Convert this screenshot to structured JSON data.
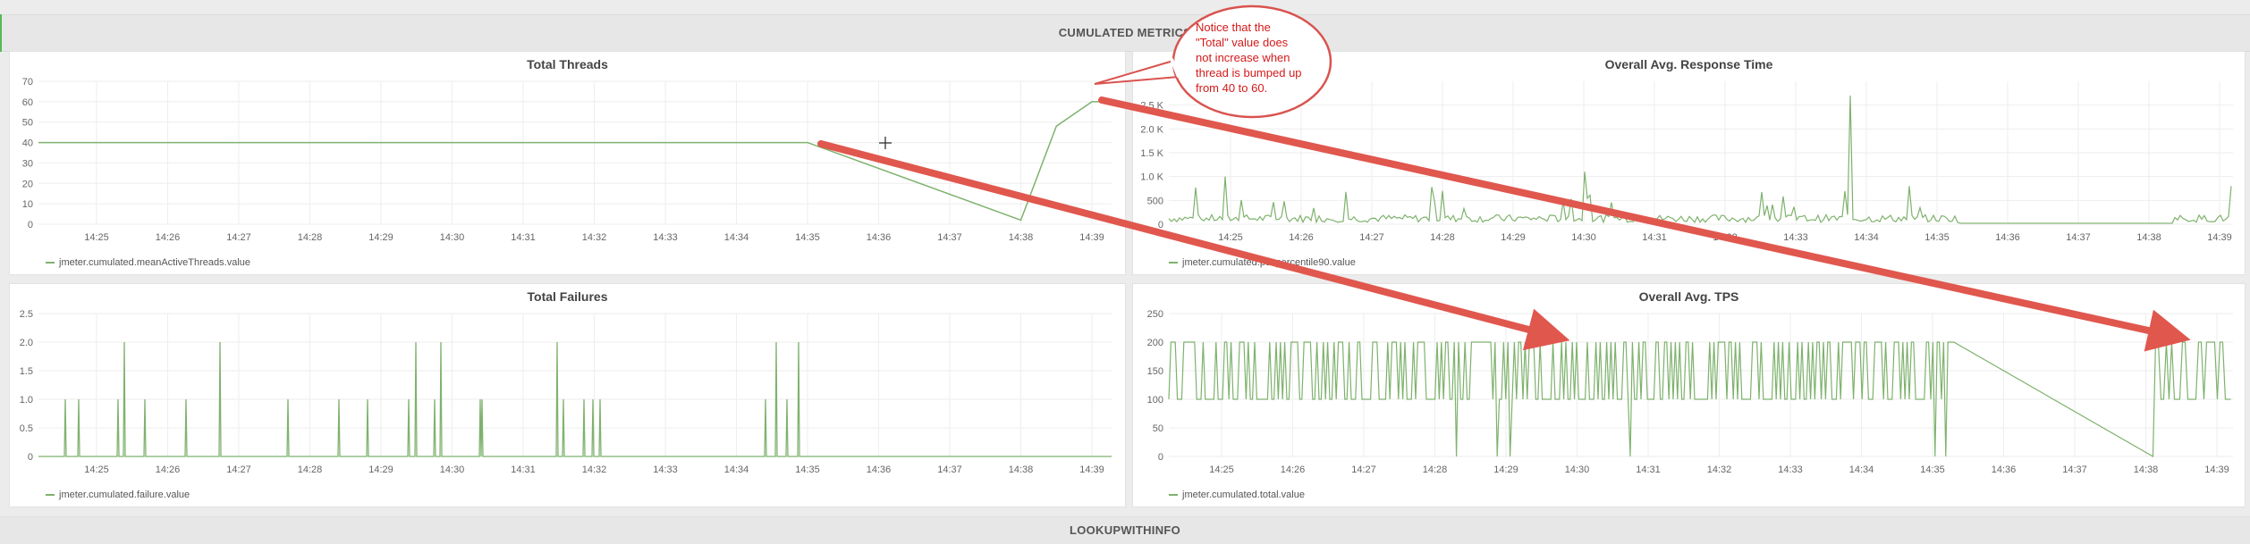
{
  "section_top_title": "CUMULATED METRICS",
  "section_bottom_title": "LOOKUPWITHINFO",
  "callout": {
    "text": "Notice that the \"Total\" value does not increase when thread is bumped up from 40 to 60."
  },
  "colors": {
    "series": "#7eb26d",
    "arrow": "#e0574e",
    "callout_text": "#d41a1a",
    "grid": "#eeeeee"
  },
  "panels": {
    "threads": {
      "title": "Total Threads",
      "legend": "jmeter.cumulated.meanActiveThreads.value",
      "chart_data": {
        "type": "line",
        "title": "Total Threads",
        "ylim": [
          0,
          70
        ],
        "yticks": [
          "0",
          "10",
          "20",
          "30",
          "40",
          "50",
          "60",
          "70"
        ],
        "xticks": [
          "14:25",
          "14:26",
          "14:27",
          "14:28",
          "14:29",
          "14:30",
          "14:31",
          "14:32",
          "14:33",
          "14:34",
          "14:35",
          "14:36",
          "14:37",
          "14:38",
          "14:39"
        ],
        "series": [
          {
            "name": "jmeter.cumulated.meanActiveThreads.value",
            "x": [
              14.25,
              14.35,
              14.38,
              14.385,
              14.39,
              14.394
            ],
            "y": [
              40,
              40,
              2,
              48,
              60,
              60
            ]
          }
        ]
      }
    },
    "response": {
      "title": "Overall Avg. Response Time",
      "legend": "jmeter.cumulated.pct.percentile90.value",
      "chart_data": {
        "type": "line",
        "title": "Overall Avg. Response Time",
        "ylim": [
          0,
          3000
        ],
        "yticks": [
          "0",
          "500",
          "1.0 K",
          "1.5 K",
          "2.0 K",
          "2.5 K"
        ],
        "xticks": [
          "14:25",
          "14:26",
          "14:27",
          "14:28",
          "14:29",
          "14:30",
          "14:31",
          "14:32",
          "14:33",
          "14:34",
          "14:35",
          "14:36",
          "14:37",
          "14:38",
          "14:39"
        ],
        "series": [
          {
            "name": "jmeter.cumulated.pct.percentile90.value",
            "pattern": "noisy baseline ~100 with spikes (e.g. 2.7 K near 14:33), flat after 14:35, noisy again after 14:38"
          }
        ]
      }
    },
    "failures": {
      "title": "Total Failures",
      "legend": "jmeter.cumulated.failure.value",
      "chart_data": {
        "type": "line",
        "title": "Total Failures",
        "ylim": [
          0,
          2.5
        ],
        "yticks": [
          "0",
          "0.5",
          "1.0",
          "1.5",
          "2.0",
          "2.5"
        ],
        "xticks": [
          "14:25",
          "14:26",
          "14:27",
          "14:28",
          "14:29",
          "14:30",
          "14:31",
          "14:32",
          "14:33",
          "14:34",
          "14:35",
          "14:36",
          "14:37",
          "14:38",
          "14:39"
        ],
        "series": [
          {
            "name": "jmeter.cumulated.failure.value",
            "spikes": [
              1,
              1,
              1,
              2,
              1,
              1,
              2,
              1,
              1,
              1,
              1,
              2,
              1,
              2,
              1,
              1,
              2,
              1,
              1,
              1,
              1,
              1,
              2,
              1,
              2
            ]
          }
        ]
      }
    },
    "tps": {
      "title": "Overall Avg. TPS",
      "legend": "jmeter.cumulated.total.value",
      "chart_data": {
        "type": "line",
        "title": "Overall Avg. TPS",
        "ylim": [
          0,
          250
        ],
        "yticks": [
          "0",
          "50",
          "100",
          "150",
          "200",
          "250"
        ],
        "xticks": [
          "14:25",
          "14:26",
          "14:27",
          "14:28",
          "14:29",
          "14:30",
          "14:31",
          "14:32",
          "14:33",
          "14:34",
          "14:35",
          "14:36",
          "14:37",
          "14:38",
          "14:39"
        ],
        "series": [
          {
            "name": "jmeter.cumulated.total.value",
            "pattern": "oscillating between 100 and 200 until 14:35, linear gap down to 0 at 14:38, then 100-200 again"
          }
        ]
      }
    }
  }
}
